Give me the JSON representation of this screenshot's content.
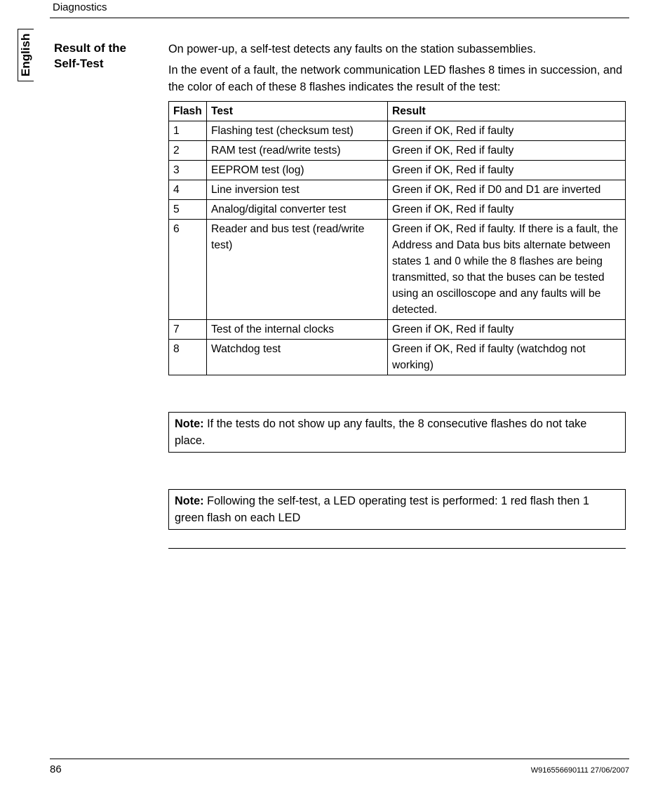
{
  "header": {
    "section": "Diagnostics"
  },
  "language": "English",
  "section_title": "Result of the Self-Test",
  "intro": {
    "p1": "On power-up, a self-test detects any faults on the station subassemblies.",
    "p2": "In the event of a fault, the network communication LED flashes 8 times in succession, and the color of each of these 8 flashes indicates the result of the test:"
  },
  "table": {
    "headers": {
      "flash": "Flash",
      "test": "Test",
      "result": "Result"
    },
    "rows": [
      {
        "flash": "1",
        "test": "Flashing test (checksum test)",
        "result": "Green if OK, Red if faulty"
      },
      {
        "flash": "2",
        "test": "RAM test (read/write tests)",
        "result": "Green if OK, Red if faulty"
      },
      {
        "flash": "3",
        "test": "EEPROM test (log)",
        "result": "Green if OK, Red if faulty"
      },
      {
        "flash": "4",
        "test": "Line inversion test",
        "result": "Green if OK, Red if D0 and D1 are inverted"
      },
      {
        "flash": "5",
        "test": "Analog/digital converter test",
        "result": "Green if OK, Red if faulty"
      },
      {
        "flash": "6",
        "test": "Reader and bus test (read/write test)",
        "result": "Green if OK, Red if faulty. If there is a fault, the Address and Data bus bits alternate between states 1 and 0 while the 8 flashes are being transmitted, so that the buses can be tested using an oscilloscope and any faults will be detected."
      },
      {
        "flash": "7",
        "test": "Test of the internal clocks",
        "result": "Green if OK, Red if faulty"
      },
      {
        "flash": "8",
        "test": "Watchdog test",
        "result": "Green if OK, Red if faulty (watchdog not working)"
      }
    ]
  },
  "notes": {
    "note_label": "Note:",
    "n1": " If the tests do not show up any faults, the 8 consecutive flashes do not take place.",
    "n2": " Following the self-test, a LED operating test is performed: 1 red flash then 1 green flash on each LED"
  },
  "footer": {
    "page": "86",
    "docid": "W916556690111 27/06/2007"
  }
}
